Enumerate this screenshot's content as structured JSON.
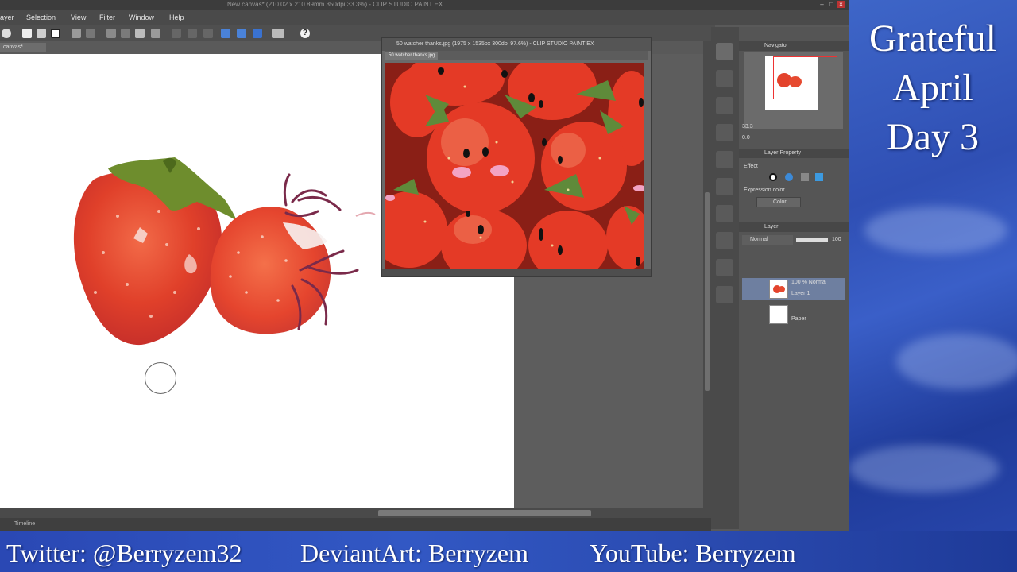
{
  "window": {
    "title": "New canvas* (210.02 x 210.89mm 350dpi 33.3%)  -  CLIP STUDIO PAINT EX"
  },
  "menu": [
    "ayer",
    "Selection",
    "View",
    "Filter",
    "Window",
    "Help"
  ],
  "canvas_tab": "canvas*",
  "reference_window": {
    "title": "50 watcher thanks.jpg (1975 x 1535px 300dpi 97.6%) - CLIP STUDIO PAINT EX",
    "tab": "50 watcher thanks.jpg"
  },
  "timeline_label": "Timeline",
  "panels": {
    "navigator_title": "Navigator",
    "navigator_zoom": "33.3",
    "navigator_rotate": "0.0",
    "layer_property_title": "Layer Property",
    "effect_label": "Effect",
    "expression_color_label": "Expression color",
    "color_dropdown": "Color",
    "layer_title": "Layer",
    "blend_mode": "Normal",
    "opacity": "100",
    "layers": [
      {
        "line1": "100 % Normal",
        "line2": "Layer 1"
      },
      {
        "line1": "",
        "line2": "Paper"
      }
    ]
  },
  "banner": {
    "line1": "Grateful",
    "line2": "April",
    "line3": "Day 3"
  },
  "footer": {
    "twitter": "Twitter: @Berryzem32",
    "deviantart": "DeviantArt: Berryzem",
    "youtube": "YouTube: Berryzem"
  },
  "colors": {
    "banner_blue": "#2f4fb4",
    "strawberry_red": "#e8442c",
    "leaf_green": "#6d8c2e",
    "stem_purple": "#7a2a4a",
    "nav_frame_red": "#e33333"
  }
}
